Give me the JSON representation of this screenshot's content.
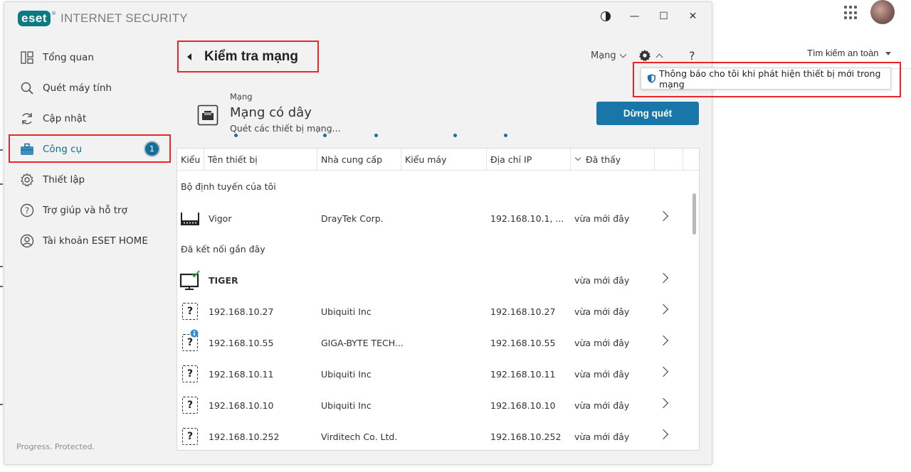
{
  "browser": {
    "search_label": "Tìm kiếm an toàn"
  },
  "app": {
    "brand": "eset",
    "product": "INTERNET SECURITY",
    "status": "Progress. Protected."
  },
  "window_controls": {
    "contrast": "contrast-icon",
    "minimize": "—",
    "maximize": "☐",
    "close": "✕"
  },
  "sidebar": {
    "items": [
      {
        "label": "Tổng quan",
        "icon": "overview-icon"
      },
      {
        "label": "Quét máy tính",
        "icon": "search-icon"
      },
      {
        "label": "Cập nhật",
        "icon": "refresh-icon"
      },
      {
        "label": "Công cụ",
        "icon": "briefcase-icon",
        "active": true,
        "badge": "1"
      },
      {
        "label": "Thiết lập",
        "icon": "gear-icon"
      },
      {
        "label": "Trợ giúp và hỗ trợ",
        "icon": "help-icon"
      },
      {
        "label": "Tài khoản ESET HOME",
        "icon": "account-icon"
      }
    ]
  },
  "header": {
    "title": "Kiểm tra mạng",
    "network_select": "Mạng",
    "help": "?"
  },
  "popup": {
    "text": "Thông báo cho tôi khi phát hiện thiết bị mới trong mạng"
  },
  "network": {
    "label": "Mạng",
    "name": "Mạng có dây",
    "status": "Quét các thiết bị mạng..."
  },
  "stop_button": "Dừng quét",
  "table": {
    "columns": [
      "Kiểu",
      "Tên thiết bị",
      "Nhà cung cấp",
      "Kiểu máy",
      "Địa chỉ IP",
      "Đã thấy"
    ],
    "groups": [
      "Bộ định tuyến của tôi",
      "Đã kết nối gần đây"
    ],
    "rows": [
      {
        "icon": "router-icon",
        "name": "Vigor",
        "vendor": "DrayTek Corp.",
        "model": "",
        "ip": "192.168.10.1, ...",
        "seen": "vừa mới đây"
      },
      {
        "icon": "monitor-check-icon",
        "name": "TIGER",
        "vendor": "",
        "model": "",
        "ip": "",
        "seen": "vừa mới đây"
      },
      {
        "icon": "unknown-device-icon",
        "name": "192.168.10.27",
        "vendor": "Ubiquiti Inc",
        "model": "",
        "ip": "192.168.10.27",
        "seen": "vừa mới đây"
      },
      {
        "icon": "unknown-device-info-icon",
        "name": "192.168.10.55",
        "vendor": "GIGA-BYTE TECH...",
        "model": "",
        "ip": "192.168.10.55",
        "seen": "vừa mới đây"
      },
      {
        "icon": "unknown-device-icon",
        "name": "192.168.10.11",
        "vendor": "Ubiquiti Inc",
        "model": "",
        "ip": "192.168.10.11",
        "seen": "vừa mới đây"
      },
      {
        "icon": "unknown-device-icon",
        "name": "192.168.10.10",
        "vendor": "Ubiquiti Inc",
        "model": "",
        "ip": "192.168.10.10",
        "seen": "vừa mới đây"
      },
      {
        "icon": "unknown-device-icon",
        "name": "192.168.10.252",
        "vendor": "Virditech Co. Ltd.",
        "model": "",
        "ip": "192.168.10.252",
        "seen": "vừa mới đây"
      }
    ]
  },
  "colors": {
    "accent": "#1877a8",
    "brand": "#0b7a82",
    "highlight": "#e8262c"
  }
}
